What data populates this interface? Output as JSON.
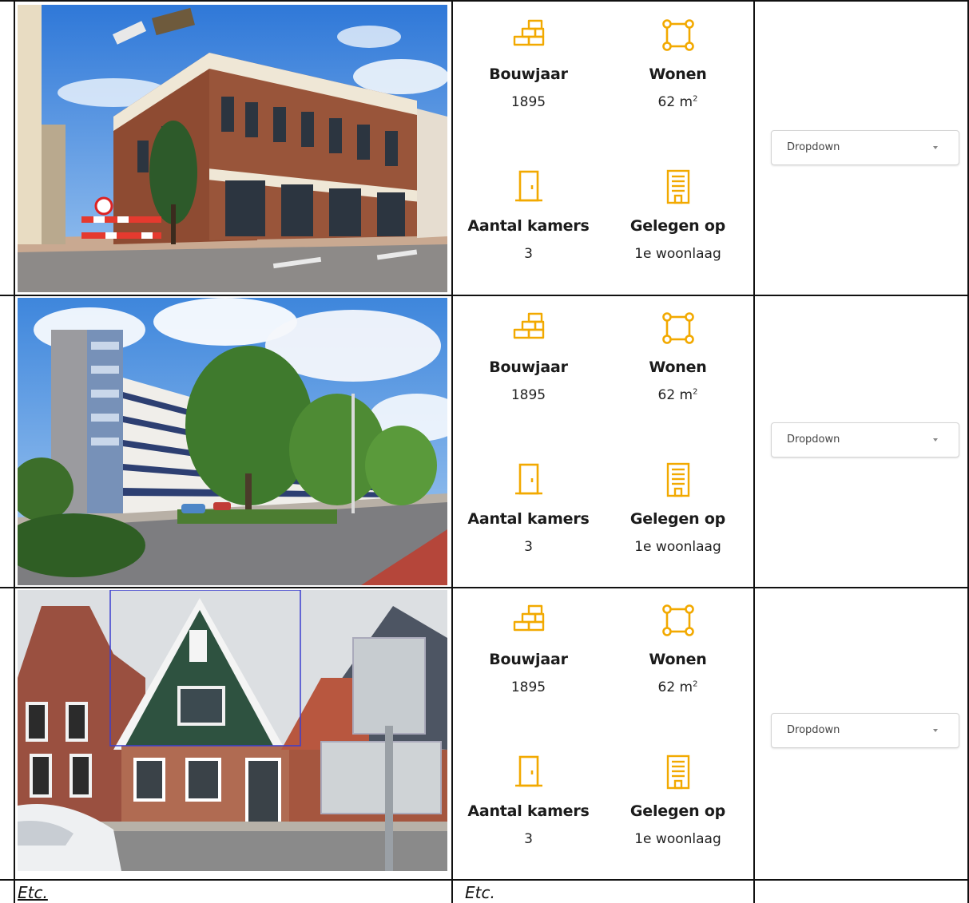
{
  "listings": [
    {
      "photo_icon": "corner-townhouse-photo",
      "stats": [
        {
          "icon": "bricks-icon",
          "label": "Bouwjaar",
          "value": "1895"
        },
        {
          "icon": "floor-area-icon",
          "label": "Wonen",
          "value": "62 m",
          "sup": "2"
        },
        {
          "icon": "door-icon",
          "label": "Aantal kamers",
          "value": "3"
        },
        {
          "icon": "building-icon",
          "label": "Gelegen op",
          "value": "1e woonlaag"
        }
      ],
      "dropdown": {
        "label": "Dropdown"
      }
    },
    {
      "photo_icon": "apartment-block-photo",
      "stats": [
        {
          "icon": "bricks-icon",
          "label": "Bouwjaar",
          "value": "1895"
        },
        {
          "icon": "floor-area-icon",
          "label": "Wonen",
          "value": "62 m",
          "sup": "2"
        },
        {
          "icon": "door-icon",
          "label": "Aantal kamers",
          "value": "3"
        },
        {
          "icon": "building-icon",
          "label": "Gelegen op",
          "value": "1e woonlaag"
        }
      ],
      "dropdown": {
        "label": "Dropdown"
      }
    },
    {
      "photo_icon": "brick-houses-photo",
      "stats": [
        {
          "icon": "bricks-icon",
          "label": "Bouwjaar",
          "value": "1895"
        },
        {
          "icon": "floor-area-icon",
          "label": "Wonen",
          "value": "62 m",
          "sup": "2"
        },
        {
          "icon": "door-icon",
          "label": "Aantal kamers",
          "value": "3"
        },
        {
          "icon": "building-icon",
          "label": "Gelegen op",
          "value": "1e woonlaag"
        }
      ],
      "dropdown": {
        "label": "Dropdown"
      }
    }
  ],
  "footer": {
    "col1": "Etc.",
    "col2": "Etc."
  },
  "colors": {
    "icon": "#F2A900",
    "border": "#111111"
  }
}
